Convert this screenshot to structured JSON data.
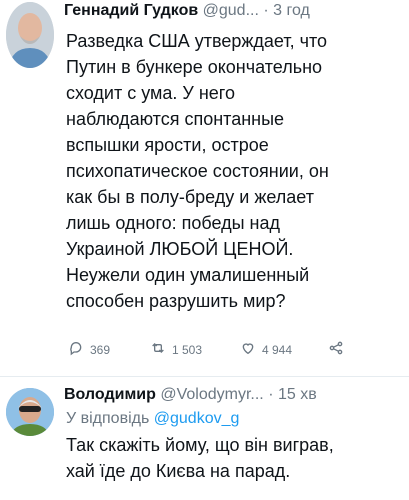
{
  "tweets": [
    {
      "name": "Геннадий Гудков",
      "handle": "@gud...",
      "separator": "·",
      "time": "3 год",
      "text": "Разведка США утверждает, что\nПутин в бункере окончательно\nсходит с ума. У него\nнаблюдаются спонтанные\nвспышки ярости, острое\nпсихопатическое состоянии, он\nкак бы в полу-бреду и желает\nлишь одного: победы над\nУкраиной ЛЮБОЙ ЦЕНОЙ.\nНеужели один умалишенный\nспособен разрушить мир?",
      "replies": "369",
      "retweets": "1 503",
      "likes": "4 944"
    },
    {
      "name": "Володимир",
      "handle": "@Volodymyr...",
      "separator": "·",
      "time": "15 хв",
      "reply_prefix": "У відповідь",
      "reply_handle": "@gudkov_g",
      "text": "Так скажіть йому, що він виграв,\nхай їде до Києва на парад."
    }
  ],
  "icons": {
    "reply": "reply-icon",
    "retweet": "retweet-icon",
    "like": "like-icon",
    "share": "share-icon"
  },
  "colors": {
    "accent": "#1d9bf0",
    "muted": "#6b7782"
  }
}
